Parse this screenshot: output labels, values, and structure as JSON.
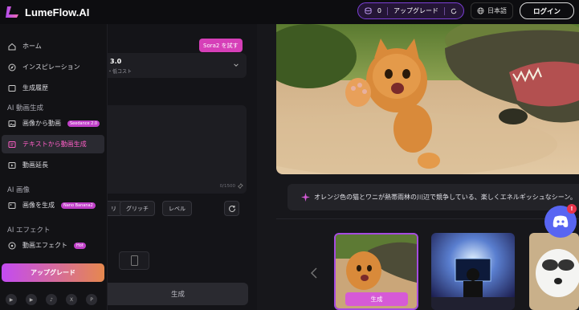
{
  "header": {
    "brand": "LumeFlow.AI",
    "credits": "0",
    "upgrade_label": "アップグレード",
    "language": "日本語",
    "login_label": "ログイン"
  },
  "sidebar": {
    "items": [
      {
        "label": "ホーム",
        "icon": "home-icon"
      },
      {
        "label": "インスピレーション",
        "icon": "compass-icon"
      },
      {
        "label": "生成履歴",
        "icon": "folder-icon"
      }
    ],
    "section_video": "AI 動画生成",
    "video_items": [
      {
        "label": "画像から動画",
        "badge": "Seedance 2.0",
        "icon": "image-icon"
      },
      {
        "label": "テキストから動画生成",
        "icon": "text-icon",
        "active": true
      },
      {
        "label": "動画延長",
        "icon": "extend-icon"
      }
    ],
    "section_image": "AI 画像",
    "image_items": [
      {
        "label": "画像を生成",
        "badge": "Nano Banana2",
        "icon": "image-icon"
      }
    ],
    "section_effects": "AI エフェクト",
    "effect_items": [
      {
        "label": "動画エフェクト",
        "badge": "Hot",
        "icon": "effects-icon"
      }
    ],
    "upgrade_button": "アップグレード",
    "socials": [
      "youtube-icon",
      "youtube-icon",
      "tiktok-icon",
      "x-icon",
      "pinterest-icon"
    ]
  },
  "form": {
    "sora_tag": "Sora2 を試す",
    "model_name": "3.0",
    "model_sub": "・低コスト",
    "char_count": "0/1500",
    "tags": [
      "リ",
      "グリッチ",
      "レベル"
    ],
    "generate_label": "生成"
  },
  "preview": {
    "caption": "オレンジ色の猫とワニが熱帯雨林の川辺で競争している、楽しくエネルギッシュなシーン。",
    "thumb_generate_label": "生成"
  },
  "discord": {
    "badge": "!"
  }
}
